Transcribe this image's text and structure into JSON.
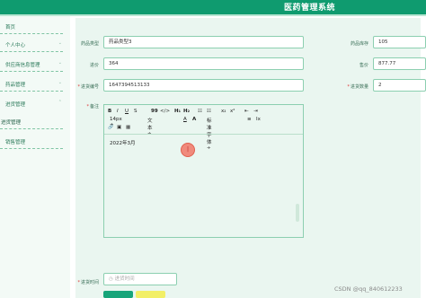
{
  "app": {
    "title": "医药管理系统"
  },
  "sidebar": {
    "items": [
      {
        "label": "首页"
      },
      {
        "label": "个人中心"
      },
      {
        "label": "供应商信息管理"
      },
      {
        "label": "药品管理"
      },
      {
        "label": "进货管理"
      },
      {
        "label": "进货管理"
      },
      {
        "label": "销售管理"
      }
    ]
  },
  "form": {
    "drug_type": {
      "label": "药品类型",
      "value": "药品类型3"
    },
    "price": {
      "label": "进价",
      "value": "364"
    },
    "purchase_no": {
      "label": "进货编号",
      "value": "1647394513133"
    },
    "stock": {
      "label": "药品库存",
      "value": "105"
    },
    "selling_price": {
      "label": "售价",
      "value": "877.77"
    },
    "purchase_qty": {
      "label": "进货数量",
      "value": "2"
    },
    "remark": {
      "label": "备注"
    },
    "purchase_time": {
      "label": "进货时间",
      "placeholder": "进货时间"
    }
  },
  "editor": {
    "toolbar": {
      "bold": "B",
      "italic": "I",
      "underline": "U",
      "strike": "S",
      "quote": "99",
      "code": "</>",
      "h1": "H₁",
      "h2": "H₂",
      "ol": "☷",
      "ul": "☷",
      "sub": "x₂",
      "sup": "x²",
      "indent_left": "⇤",
      "indent_right": "⇥",
      "font_size": "14px",
      "font_size_arrow": "÷",
      "text_type": "文本",
      "text_type_arrow": "÷",
      "font_color": "A",
      "bg_color": "A",
      "font_family": "标准字体",
      "font_family_arrow": "÷",
      "align": "≡",
      "clean": "Ix",
      "link": "🔗",
      "image": "▣",
      "video": "▦"
    },
    "content": "2022年3月"
  },
  "watermark": "CSDN @qq_840612233"
}
